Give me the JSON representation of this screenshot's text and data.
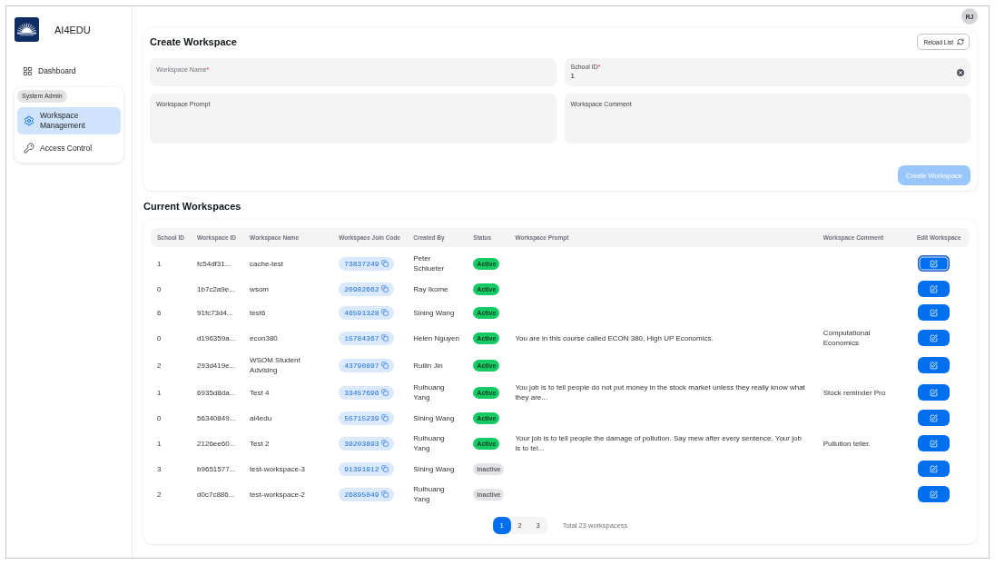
{
  "sidebar": {
    "brand": "AI4EDU",
    "items": [
      {
        "label": "Dashboard",
        "selected": false
      }
    ],
    "groups": [
      {
        "title": "System Admin",
        "items": [
          {
            "label": "Workspace Management",
            "selected": true
          },
          {
            "label": "Access Control",
            "selected": false
          }
        ]
      }
    ]
  },
  "header": {
    "avatar": "RJ"
  },
  "create_form": {
    "title": "Create Workspace",
    "reload_button": "Reload List",
    "fields": [
      {
        "kind": "input",
        "label": "Workspace Name",
        "required_mark": "*"
      },
      {
        "kind": "input",
        "label": "School ID",
        "required_mark": "*",
        "value": "1",
        "clearable": true
      },
      {
        "kind": "textarea",
        "label": "Workspace Prompt"
      },
      {
        "kind": "textarea",
        "label": "Workspace Comment"
      }
    ],
    "submit_button": {
      "label": "Create Workspace",
      "disabled": true
    }
  },
  "workspaces": {
    "title": "Current Workspaces",
    "table": {
      "columns": [
        "School ID",
        "Workspace ID",
        "Workspace Name",
        "Workspace Join Code",
        "Created By",
        "Status",
        "Workspace Prompt",
        "Workspace Comment",
        "Edit Workspace"
      ],
      "rows": [
        {
          "school_id": "1",
          "workspace_id": "fc54df31...",
          "name": "cache-test",
          "join_code": "73837249",
          "created_by": "Peter Schlueter",
          "status": {
            "label": "Active",
            "active": true
          },
          "edit_focused": true
        },
        {
          "school_id": "0",
          "workspace_id": "1b7c2a9e...",
          "name": "wsom",
          "join_code": "20982662",
          "created_by": "Ray Ikome",
          "status": {
            "label": "Active",
            "active": true
          },
          "edit_focused": false
        },
        {
          "school_id": "6",
          "workspace_id": "91fc73d4...",
          "name": "test6",
          "join_code": "46591328",
          "created_by": "Sining Wang",
          "status": {
            "label": "Active",
            "active": true
          },
          "edit_focused": false
        },
        {
          "school_id": "0",
          "workspace_id": "d196359a...",
          "name": "econ380",
          "join_code": "15784367",
          "created_by": "Helen Nguyen",
          "status": {
            "label": "Active",
            "active": true
          },
          "prompt": "You are in this course called ECON 380, High UP Economics.",
          "comment": "Computational Economics",
          "edit_focused": false
        },
        {
          "school_id": "2",
          "workspace_id": "293d419e...",
          "name": "WSOM Student Advising",
          "join_code": "43790897",
          "created_by": "Ruilin Jin",
          "status": {
            "label": "Active",
            "active": true
          },
          "edit_focused": false
        },
        {
          "school_id": "1",
          "workspace_id": "6935d8da...",
          "name": "Test 4",
          "join_code": "33457696",
          "created_by": "Ruihuang Yang",
          "status": {
            "label": "Active",
            "active": true
          },
          "prompt": "You job is to tell people do not put money in the stock market unless they really know what they are...",
          "comment": "Stock reminder Pro",
          "edit_focused": false
        },
        {
          "school_id": "0",
          "workspace_id": "56340849...",
          "name": "ai4edu",
          "join_code": "55715239",
          "created_by": "Sining Wang",
          "status": {
            "label": "Active",
            "active": true
          },
          "edit_focused": false
        },
        {
          "school_id": "1",
          "workspace_id": "2126ee60...",
          "name": "Test 2",
          "join_code": "39203893",
          "created_by": "Ruihuang Yang",
          "status": {
            "label": "Active",
            "active": true
          },
          "prompt": "Your job is to tell people the damage of pollution. Say mew after every sentence. Your job is to tel...",
          "comment": "Pullution teller.",
          "edit_focused": false
        },
        {
          "school_id": "3",
          "workspace_id": "b9651577...",
          "name": "test-workspace-3",
          "join_code": "91391912",
          "created_by": "Sining Wang",
          "status": {
            "label": "Inactive",
            "active": false
          },
          "edit_focused": false
        },
        {
          "school_id": "2",
          "workspace_id": "d0c7c886...",
          "name": "test-workspace-2",
          "join_code": "26895049",
          "created_by": "Ruihuang Yang",
          "status": {
            "label": "Inactive",
            "active": false
          },
          "edit_focused": false
        }
      ]
    },
    "pagination": {
      "pages": [
        {
          "label": "1",
          "selected": true
        },
        {
          "label": "2",
          "selected": false
        },
        {
          "label": "3",
          "selected": false
        }
      ],
      "total": "Total 23 workspacess"
    }
  }
}
